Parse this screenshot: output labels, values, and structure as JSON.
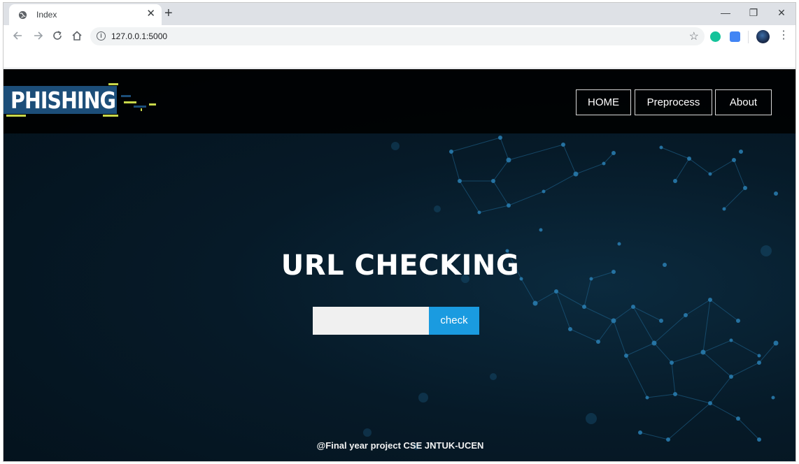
{
  "browser": {
    "tab_title": "Index",
    "tab_close": "✕",
    "new_tab": "+",
    "url": "127.0.0.1:5000",
    "icons": [
      "globe-icon",
      "back-icon",
      "forward-icon",
      "reload-icon",
      "home-icon",
      "info-icon",
      "star-icon",
      "grammarly-icon",
      "translate-icon",
      "profile-icon",
      "menu-icon"
    ],
    "window_controls": {
      "minimize": "—",
      "restore": "❐",
      "close": "✕"
    }
  },
  "header": {
    "logo_text": "PHISHING",
    "nav": [
      {
        "label": "HOME"
      },
      {
        "label": "Preprocess"
      },
      {
        "label": "About"
      }
    ]
  },
  "hero": {
    "title": "URL CHECKING",
    "input_value": "",
    "button_label": "check"
  },
  "footer": {
    "text": "@Final year project CSE JNTUK-UCEN"
  },
  "colors": {
    "page_bg": "#061a28",
    "header_bg": "#000000",
    "accent_button": "#1a9be0",
    "logo_box": "#1c4e79",
    "logo_accent": "#c8d84a"
  }
}
